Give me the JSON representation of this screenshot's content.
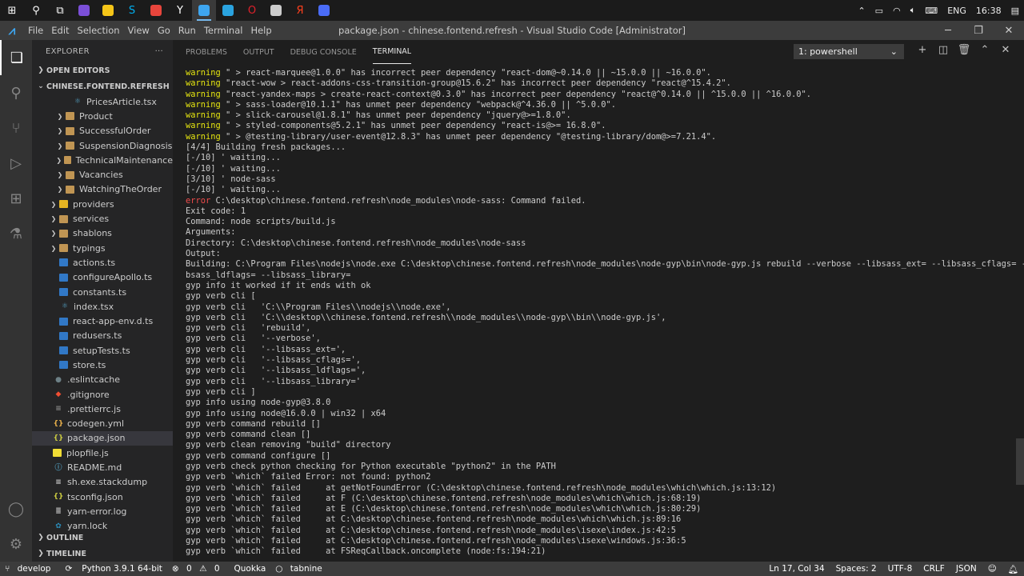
{
  "taskbar": {
    "apps": [
      {
        "icon": "windows-start-icon",
        "color": "#ffffff",
        "glyph": "⊞"
      },
      {
        "icon": "search-icon",
        "color": "#ffffff",
        "glyph": "⚲"
      },
      {
        "icon": "task-view-icon",
        "color": "#ffffff",
        "glyph": "⧉"
      },
      {
        "icon": "app-purple-icon",
        "color": "#7b4fd8",
        "glyph": ""
      },
      {
        "icon": "app-yellow-icon",
        "color": "#f5c518",
        "glyph": ""
      },
      {
        "icon": "skype-icon",
        "color": "#00aff0",
        "glyph": "S"
      },
      {
        "icon": "chrome-icon",
        "color": "#e8453c",
        "glyph": ""
      },
      {
        "icon": "yandex-browser-icon",
        "color": "#ffffff",
        "glyph": "Y"
      },
      {
        "icon": "vscode-icon",
        "color": "#3ea6f0",
        "glyph": "",
        "active": true
      },
      {
        "icon": "telegram-icon",
        "color": "#2aa3df",
        "glyph": ""
      },
      {
        "icon": "opera-icon",
        "color": "#e0202b",
        "glyph": "O"
      },
      {
        "icon": "lock-app-icon",
        "color": "#cccccc",
        "glyph": ""
      },
      {
        "icon": "yandex-icon",
        "color": "#fc3f1d",
        "glyph": "Я"
      },
      {
        "icon": "app-blue-icon",
        "color": "#4a6cf7",
        "glyph": ""
      }
    ],
    "lang": "ENG",
    "time": "16:38"
  },
  "titlebar": {
    "menu": [
      "File",
      "Edit",
      "Selection",
      "View",
      "Go",
      "Run",
      "Terminal",
      "Help"
    ],
    "title": "package.json - chinese.fontend.refresh - Visual Studio Code [Administrator]"
  },
  "sidebar": {
    "header": "EXPLORER",
    "open_editors": "OPEN EDITORS",
    "project": "CHINESE.FONTEND.REFRESH",
    "items": [
      {
        "label": "PricesArticle.tsx",
        "kind": "tsx",
        "depth": 3
      },
      {
        "label": "Product",
        "kind": "folder",
        "depth": 2
      },
      {
        "label": "SuccessfulOrder",
        "kind": "folder",
        "depth": 2
      },
      {
        "label": "SuspensionDiagnosis",
        "kind": "folder",
        "depth": 2
      },
      {
        "label": "TechnicalMaintenance",
        "kind": "folder",
        "depth": 2
      },
      {
        "label": "Vacancies",
        "kind": "folder",
        "depth": 2
      },
      {
        "label": "WatchingTheOrder",
        "kind": "folder",
        "depth": 2
      },
      {
        "label": "providers",
        "kind": "folder-y",
        "depth": 1
      },
      {
        "label": "services",
        "kind": "folder",
        "depth": 1
      },
      {
        "label": "shablons",
        "kind": "folder",
        "depth": 1
      },
      {
        "label": "typings",
        "kind": "folder",
        "depth": 1
      },
      {
        "label": "actions.ts",
        "kind": "ts",
        "depth": 1
      },
      {
        "label": "configureApollo.ts",
        "kind": "ts",
        "depth": 1
      },
      {
        "label": "constants.ts",
        "kind": "ts",
        "depth": 1
      },
      {
        "label": "index.tsx",
        "kind": "tsx",
        "depth": 1
      },
      {
        "label": "react-app-env.d.ts",
        "kind": "ts",
        "depth": 1
      },
      {
        "label": "redusers.ts",
        "kind": "ts",
        "depth": 1
      },
      {
        "label": "setupTests.ts",
        "kind": "ts",
        "depth": 1
      },
      {
        "label": "store.ts",
        "kind": "ts",
        "depth": 1
      },
      {
        "label": ".eslintcache",
        "kind": "cache",
        "depth": 0
      },
      {
        "label": ".gitignore",
        "kind": "git",
        "depth": 0
      },
      {
        "label": ".prettierrc.js",
        "kind": "prettier",
        "depth": 0
      },
      {
        "label": "codegen.yml",
        "kind": "yml",
        "depth": 0
      },
      {
        "label": "package.json",
        "kind": "json",
        "depth": 0,
        "selected": true
      },
      {
        "label": "plopfile.js",
        "kind": "js",
        "depth": 0
      },
      {
        "label": "README.md",
        "kind": "md",
        "depth": 0
      },
      {
        "label": "sh.exe.stackdump",
        "kind": "file",
        "depth": 0
      },
      {
        "label": "tsconfig.json",
        "kind": "json",
        "depth": 0
      },
      {
        "label": "yarn-error.log",
        "kind": "log",
        "depth": 0
      },
      {
        "label": "yarn.lock",
        "kind": "yarn",
        "depth": 0
      }
    ],
    "outline": "OUTLINE",
    "timeline": "TIMELINE"
  },
  "panel": {
    "tabs": [
      "PROBLEMS",
      "OUTPUT",
      "DEBUG CONSOLE",
      "TERMINAL"
    ],
    "active_tab": 3,
    "terminal_select": "1: powershell",
    "lines": [
      {
        "p": "warning",
        "t": " \" > react-marquee@1.0.0\" has incorrect peer dependency \"react-dom@~0.14.0 || ~15.0.0 || ~16.0.0\"."
      },
      {
        "p": "warning",
        "t": " \"react-wow > react-addons-css-transition-group@15.6.2\" has incorrect peer dependency \"react@^15.4.2\"."
      },
      {
        "p": "warning",
        "t": " \"react-yandex-maps > create-react-context@0.3.0\" has incorrect peer dependency \"react@^0.14.0 || ^15.0.0 || ^16.0.0\"."
      },
      {
        "p": "warning",
        "t": " \" > sass-loader@10.1.1\" has unmet peer dependency \"webpack@^4.36.0 || ^5.0.0\"."
      },
      {
        "p": "warning",
        "t": " \" > slick-carousel@1.8.1\" has unmet peer dependency \"jquery@>=1.8.0\"."
      },
      {
        "p": "warning",
        "t": " \" > styled-components@5.2.1\" has unmet peer dependency \"react-is@>= 16.8.0\"."
      },
      {
        "p": "warning",
        "t": " \" > @testing-library/user-event@12.8.3\" has unmet peer dependency \"@testing-library/dom@>=7.21.4\"."
      },
      {
        "p": "",
        "t": "[4/4] Building fresh packages..."
      },
      {
        "p": "",
        "t": "[-/10] ' waiting..."
      },
      {
        "p": "",
        "t": "[-/10] ' waiting..."
      },
      {
        "p": "",
        "t": "[3/10] ' node-sass"
      },
      {
        "p": "",
        "t": "[-/10] ' waiting..."
      },
      {
        "p": "error",
        "t": " C:\\desktop\\chinese.fontend.refresh\\node_modules\\node-sass: Command failed."
      },
      {
        "p": "",
        "t": "Exit code: 1"
      },
      {
        "p": "",
        "t": "Command: node scripts/build.js"
      },
      {
        "p": "",
        "t": "Arguments:"
      },
      {
        "p": "",
        "t": "Directory: C:\\desktop\\chinese.fontend.refresh\\node_modules\\node-sass"
      },
      {
        "p": "",
        "t": "Output:"
      },
      {
        "p": "",
        "t": "Building: C:\\Program Files\\nodejs\\node.exe C:\\desktop\\chinese.fontend.refresh\\node_modules\\node-gyp\\bin\\node-gyp.js rebuild --verbose --libsass_ext= --libsass_cflags= --li"
      },
      {
        "p": "",
        "t": "bsass_ldflags= --libsass_library="
      },
      {
        "p": "",
        "t": "gyp info it worked if it ends with ok"
      },
      {
        "p": "",
        "t": "gyp verb cli ["
      },
      {
        "p": "",
        "t": "gyp verb cli   'C:\\\\Program Files\\\\nodejs\\\\node.exe',"
      },
      {
        "p": "",
        "t": "gyp verb cli   'C:\\\\desktop\\\\chinese.fontend.refresh\\\\node_modules\\\\node-gyp\\\\bin\\\\node-gyp.js',"
      },
      {
        "p": "",
        "t": "gyp verb cli   'rebuild',"
      },
      {
        "p": "",
        "t": "gyp verb cli   '--verbose',"
      },
      {
        "p": "",
        "t": "gyp verb cli   '--libsass_ext=',"
      },
      {
        "p": "",
        "t": "gyp verb cli   '--libsass_cflags=',"
      },
      {
        "p": "",
        "t": "gyp verb cli   '--libsass_ldflags=',"
      },
      {
        "p": "",
        "t": "gyp verb cli   '--libsass_library='"
      },
      {
        "p": "",
        "t": "gyp verb cli ]"
      },
      {
        "p": "",
        "t": "gyp info using node-gyp@3.8.0"
      },
      {
        "p": "",
        "t": "gyp info using node@16.0.0 | win32 | x64"
      },
      {
        "p": "",
        "t": "gyp verb command rebuild []"
      },
      {
        "p": "",
        "t": "gyp verb command clean []"
      },
      {
        "p": "",
        "t": "gyp verb clean removing \"build\" directory"
      },
      {
        "p": "",
        "t": "gyp verb command configure []"
      },
      {
        "p": "",
        "t": "gyp verb check python checking for Python executable \"python2\" in the PATH"
      },
      {
        "p": "",
        "t": "gyp verb `which` failed Error: not found: python2"
      },
      {
        "p": "",
        "t": "gyp verb `which` failed     at getNotFoundError (C:\\desktop\\chinese.fontend.refresh\\node_modules\\which\\which.js:13:12)"
      },
      {
        "p": "",
        "t": "gyp verb `which` failed     at F (C:\\desktop\\chinese.fontend.refresh\\node_modules\\which\\which.js:68:19)"
      },
      {
        "p": "",
        "t": "gyp verb `which` failed     at E (C:\\desktop\\chinese.fontend.refresh\\node_modules\\which\\which.js:80:29)"
      },
      {
        "p": "",
        "t": "gyp verb `which` failed     at C:\\desktop\\chinese.fontend.refresh\\node_modules\\which\\which.js:89:16"
      },
      {
        "p": "",
        "t": "gyp verb `which` failed     at C:\\desktop\\chinese.fontend.refresh\\node_modules\\isexe\\index.js:42:5"
      },
      {
        "p": "",
        "t": "gyp verb `which` failed     at C:\\desktop\\chinese.fontend.refresh\\node_modules\\isexe\\windows.js:36:5"
      },
      {
        "p": "",
        "t": "gyp verb `which` failed     at FSReqCallback.oncomplete (node:fs:194:21)"
      }
    ]
  },
  "statusbar": {
    "branch": "develop",
    "python": "Python 3.9.1 64-bit",
    "errors": "0",
    "warnings": "0",
    "quokka": "Quokka",
    "tabnine": "tabnine",
    "position": "Ln 17, Col 34",
    "spaces": "Spaces: 2",
    "encoding": "UTF-8",
    "eol": "CRLF",
    "language": "JSON"
  }
}
